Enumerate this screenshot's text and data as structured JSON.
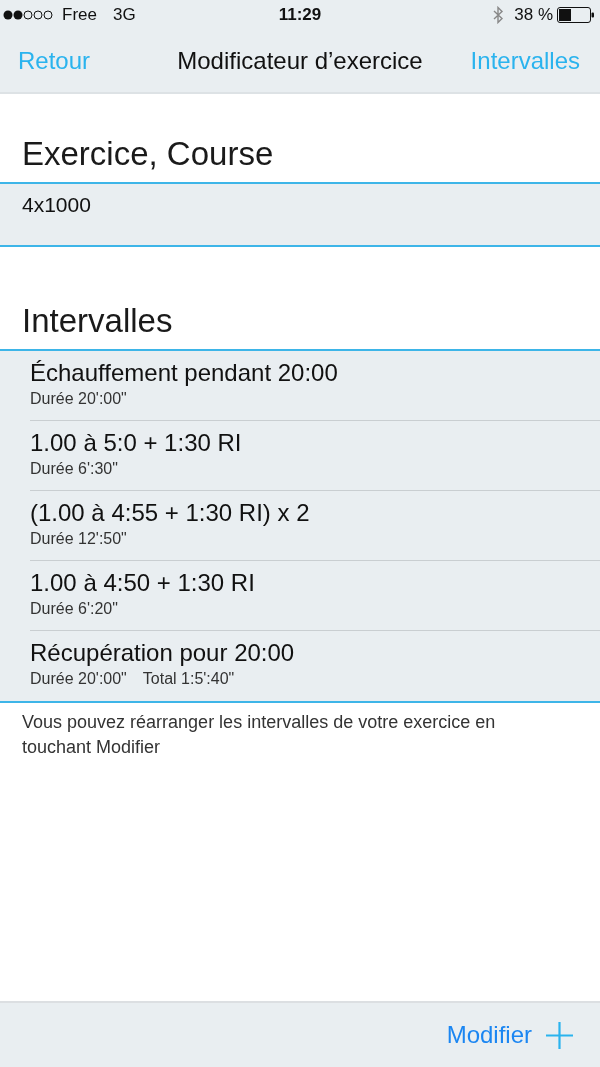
{
  "status_bar": {
    "carrier": "Free",
    "network": "3G",
    "time": "11:29",
    "battery": "38 %"
  },
  "nav_bar": {
    "back": "Retour",
    "title": "Modificateur d’exercice",
    "action": "Intervalles"
  },
  "exercise": {
    "header": "Exercice, Course",
    "name": "4x1000"
  },
  "intervals": {
    "header": "Intervalles",
    "items": [
      {
        "title": "Échauffement pendant 20:00",
        "duration": "Durée 20':00\""
      },
      {
        "title": "1.00 à 5:0 + 1:30 RI",
        "duration": "Durée 6':30\""
      },
      {
        "title": "(1.00 à 4:55 + 1:30 RI) x 2",
        "duration": "Durée 12':50\""
      },
      {
        "title": "1.00 à 4:50 + 1:30 RI",
        "duration": "Durée 6':20\""
      },
      {
        "title": "Récupération pour 20:00",
        "duration": "Durée 20':00\"",
        "total": "Total 1:5':40\""
      }
    ]
  },
  "hint": "Vous pouvez réarranger les intervalles de votre exercice en touchant Modifier",
  "toolbar": {
    "edit": "Modifier"
  }
}
